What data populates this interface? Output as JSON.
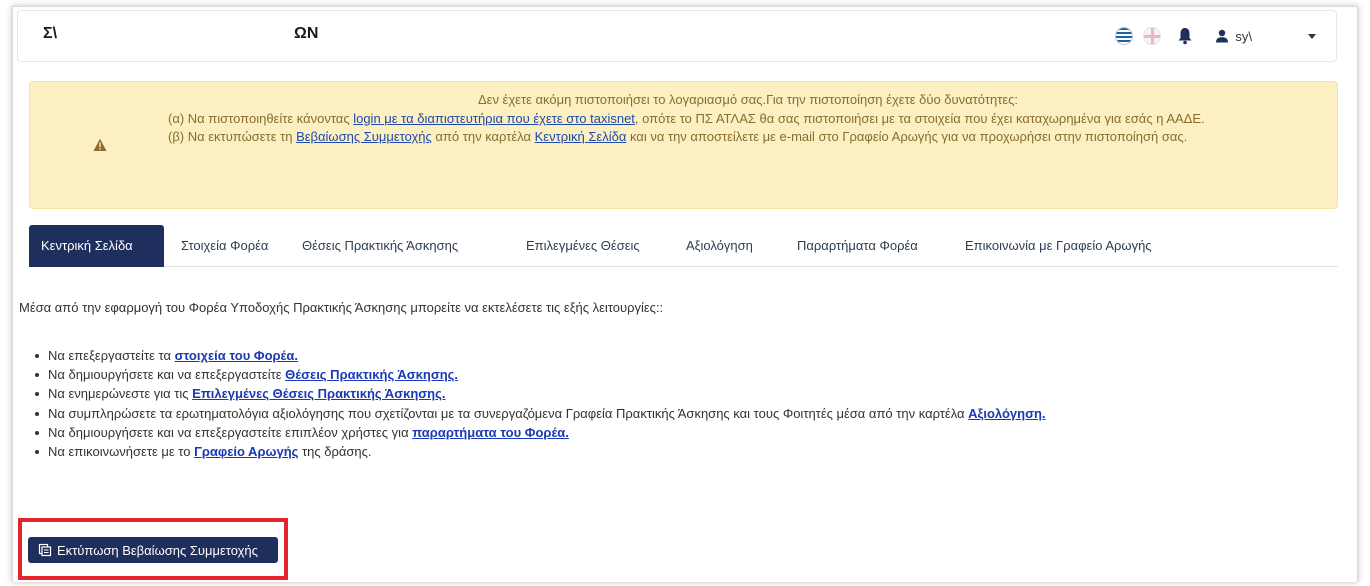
{
  "header": {
    "brand_left": "Σ\\",
    "brand_right": "ΩN",
    "user_name": "sy\\",
    "icons": [
      "greek-flag-icon",
      "uk-flag-icon",
      "bell-icon",
      "user-icon",
      "caret-down-icon"
    ]
  },
  "alert": {
    "line1": "Δεν έχετε ακόμη πιστοποιήσει το λογαριασμό σας.Για την πιστοποίηση έχετε δύο δυνατότητες:",
    "a_prefix": "(α) Να πιστοποιηθείτε κάνοντας ",
    "a_link": "login με τα διαπιστευτήρια που έχετε στο taxisnet",
    "a_suffix": ", οπότε το ΠΣ ΑΤΛΑΣ θα σας πιστοποιήσει με τα στοιχεία που έχει καταχωρημένα για εσάς η ΑΑΔΕ.",
    "b_prefix": "(β) Να εκτυπώσετε τη ",
    "b_link1": "Βεβαίωσης Συμμετοχής",
    "b_mid": " από την καρτέλα ",
    "b_link2": "Κεντρική Σελίδα",
    "b_suffix": " και να την αποστείλετε με e-mail στο Γραφείο Αρωγής για να προχωρήσει στην πιστοποίησή σας.",
    "icon": "warning-icon"
  },
  "tabs": [
    {
      "label": "Κεντρική Σελίδα",
      "active": true
    },
    {
      "label": "Στοιχεία Φορέα",
      "active": false
    },
    {
      "label": "Θέσεις Πρακτικής Άσκησης",
      "active": false
    },
    {
      "label": "Επιλεγμένες Θέσεις",
      "active": false
    },
    {
      "label": "Αξιολόγηση",
      "active": false
    },
    {
      "label": "Παραρτήματα Φορέα",
      "active": false
    },
    {
      "label": "Επικοινωνία με Γραφείο Αρωγής",
      "active": false
    }
  ],
  "main": {
    "intro": "Μέσα από την εφαρμογή του Φορέα Υποδοχής Πρακτικής Άσκησης μπορείτε να εκτελέσετε τις εξής λειτουργίες::",
    "items": [
      {
        "prefix": "Να επεξεργαστείτε τα ",
        "link": "στοιχεία του Φορέα.",
        "suffix": ""
      },
      {
        "prefix": "Να δημιουργήσετε και να επεξεργαστείτε ",
        "link": "Θέσεις Πρακτικής Άσκησης.",
        "suffix": ""
      },
      {
        "prefix": "Να ενημερώνεστε για τις ",
        "link": "Επιλεγμένες Θέσεις Πρακτικής Άσκησης.",
        "suffix": ""
      },
      {
        "prefix": "Να συμπληρώσετε τα ερωτηματολόγια αξιολόγησης που σχετίζονται με τα συνεργαζόμενα Γραφεία Πρακτικής Άσκησης και τους Φοιτητές μέσα από την καρτέλα ",
        "link": "Αξιολόγηση.",
        "suffix": ""
      },
      {
        "prefix": "Να δημιουργήσετε και να επεξεργαστείτε επιπλέον χρήστες για ",
        "link": "παραρτήματα του Φορέα.",
        "suffix": ""
      },
      {
        "prefix": "Να επικοινωνήσετε με το ",
        "link": "Γραφείο Αρωγής",
        "suffix": " της δράσης."
      }
    ],
    "print_button": "Εκτύπωση Βεβαίωσης Συμμετοχής",
    "print_icon": "print-icon"
  },
  "colors": {
    "primary": "#1e2f5d",
    "alert_bg": "#fcf0c2",
    "alert_text": "#8a6d2d",
    "link": "#1a3ab5",
    "highlight": "#e1262d"
  }
}
